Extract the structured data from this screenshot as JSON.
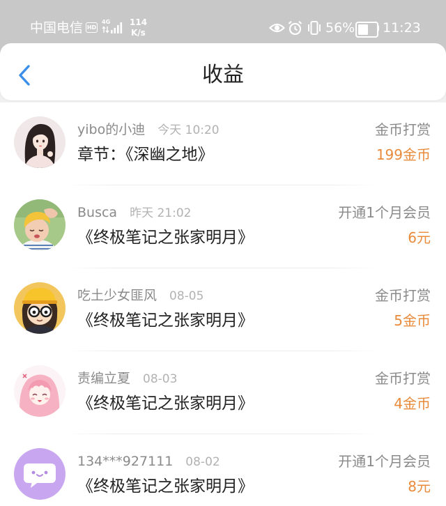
{
  "status_bar": {
    "carrier": "中国电信",
    "hd_badge": "HD",
    "network_type": "4G",
    "net_speed_value": "114",
    "net_speed_unit": "K/s",
    "battery_text": "56%",
    "battery_level": 0.56,
    "time": "11:23",
    "icons": {
      "hd": "hd-badge-icon",
      "data_arrows": "data-transfer-icon",
      "signal": "signal-bars-icon",
      "eye": "eye-comfort-icon",
      "alarm": "alarm-clock-icon",
      "vibrate": "vibrate-icon",
      "battery": "battery-icon"
    }
  },
  "header": {
    "back_icon": "chevron-left-icon",
    "title": "收益"
  },
  "colors": {
    "status_bar_bg": "#c8c8c8",
    "accent_blue": "#3b8fe8",
    "amount_orange": "#e88a3a",
    "primary_text": "#222222",
    "secondary_text": "#8a8a8a",
    "muted_text": "#b2b2b2"
  },
  "records": [
    {
      "name": "yibo的小迪",
      "time": "今天 10:20",
      "type": "金币打赏",
      "title": "章节：《深幽之地》",
      "amount": "199金币"
    },
    {
      "name": "Busca",
      "time": "昨天 21:02",
      "type": "开通1个月会员",
      "title": "《终极笔记之张家明月》",
      "amount": "6元"
    },
    {
      "name": "吃土少女匪风",
      "time": "08-05",
      "type": "金币打赏",
      "title": "《终极笔记之张家明月》",
      "amount": "5金币"
    },
    {
      "name": "责编立夏",
      "time": "08-03",
      "type": "金币打赏",
      "title": "《终极笔记之张家明月》",
      "amount": "4金币"
    },
    {
      "name": "134***927111",
      "time": "08-02",
      "type": "开通1个月会员",
      "title": "《终极笔记之张家明月》",
      "amount": "8元",
      "avatar_icon": "chat-bubble-icon"
    }
  ]
}
